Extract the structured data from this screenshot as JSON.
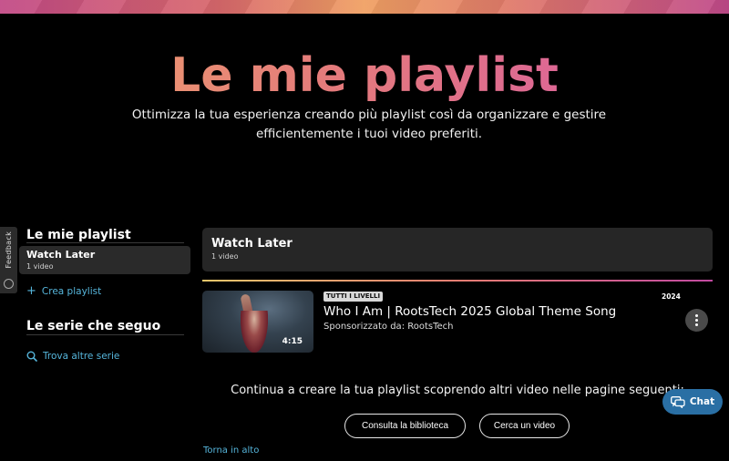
{
  "hero": {
    "title": "Le mie playlist",
    "subtitle": "Ottimizza la tua esperienza creando più playlist così da organizzare e gestire efficientemente i tuoi video preferiti."
  },
  "feedback": {
    "label": "Feedback"
  },
  "sidebar": {
    "playlists_heading": "Le mie playlist",
    "items": [
      {
        "title": "Watch Later",
        "count": "1 video"
      }
    ],
    "create_label": "Crea playlist",
    "series_heading": "Le serie che seguo",
    "find_series_label": "Trova altre serie"
  },
  "playlist": {
    "title": "Watch Later",
    "count": "1 video"
  },
  "videos": [
    {
      "badge": "TUTTI I LIVELLI",
      "year": "2024",
      "title": "Who I Am | RootsTech 2025 Global Theme Song",
      "sponsor": "Sponsorizzato da: RootsTech",
      "duration": "4:15"
    }
  ],
  "footer": {
    "continue_text": "Continua a creare la tua playlist scoprendo altri video nelle pagine seguenti:",
    "library_button": "Consulta la biblioteca",
    "search_button": "Cerca un video",
    "back_to_top": "Torna in alto"
  },
  "chat": {
    "label": "Chat"
  },
  "colors": {
    "accent_link": "#56b6dc",
    "chat_bg": "#2a6fa4",
    "card_bg": "#262626"
  }
}
